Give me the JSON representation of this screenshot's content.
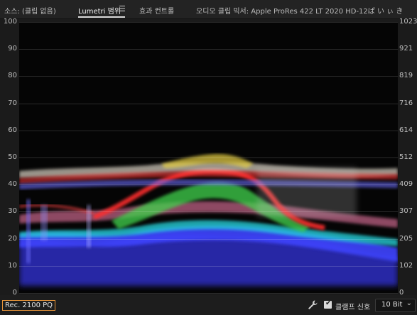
{
  "tabs": {
    "source": "소스: (클립 없음)",
    "lumetri": "Lumetri 범위",
    "effects": "효과 컨트롤",
    "mixer": "오디오 클립 믹서: Apple ProRes 422 LT 2020 HD-12ぱ い ぃ き"
  },
  "icons": {
    "panel_menu": "hamburger-menu-icon",
    "settings": "wrench-icon",
    "dropdown": "chevron-down-icon",
    "checkbox": "checkmark-icon"
  },
  "scope": {
    "type": "waveform",
    "color_space_label": "Rec. 2100 PQ",
    "left_axis": [
      "100",
      "90",
      "80",
      "70",
      "60",
      "50",
      "40",
      "30",
      "20",
      "10",
      "0"
    ],
    "right_axis": [
      "1023",
      "921",
      "819",
      "716",
      "614",
      "512",
      "409",
      "307",
      "205",
      "102",
      "0"
    ],
    "colors": {
      "accent": "#e8943a",
      "background": "#050505",
      "grid": "#2a2a2a",
      "red": "#ff2a2a",
      "green": "#3cd24a",
      "blue": "#3a40ff",
      "cyan": "#20d8e0",
      "white": "#f0f0f0",
      "yellow": "#e8d040"
    }
  },
  "footer": {
    "clamp_label": "클램프 신호",
    "clamp_checked": true,
    "bit_depth": "10 Bit"
  }
}
